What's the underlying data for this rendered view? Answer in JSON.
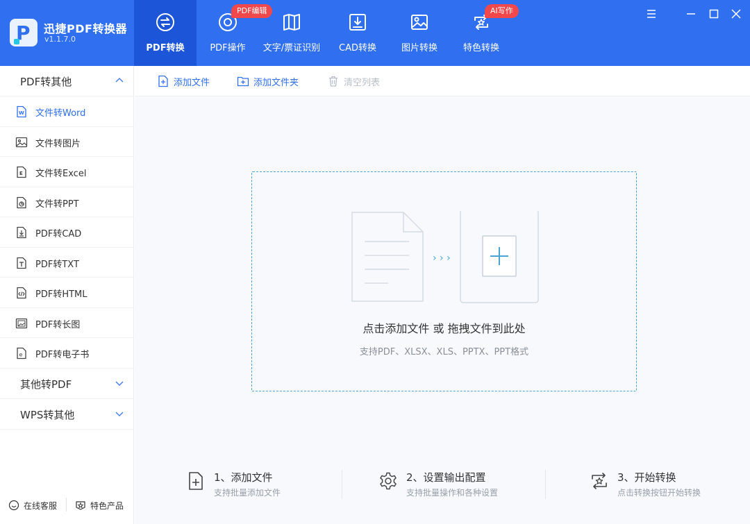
{
  "app": {
    "name": "迅捷PDF转换器",
    "version": "v1.1.7.0"
  },
  "tabs": [
    {
      "label": "PDF转换",
      "icon": "pdf-convert-icon",
      "active": true
    },
    {
      "label": "PDF操作",
      "icon": "pdf-operate-icon",
      "badge": "PDF编辑"
    },
    {
      "label": "文字/票证识别",
      "icon": "ocr-icon"
    },
    {
      "label": "CAD转换",
      "icon": "cad-icon"
    },
    {
      "label": "图片转换",
      "icon": "image-icon"
    },
    {
      "label": "特色转换",
      "icon": "special-icon",
      "badge": "AI写作"
    }
  ],
  "window_controls": [
    "menu-icon",
    "minimize-icon",
    "maximize-icon",
    "close-icon"
  ],
  "sidebar": {
    "categories": [
      {
        "label": "PDF转其他",
        "expanded": true
      },
      {
        "label": "其他转PDF",
        "expanded": false
      },
      {
        "label": "WPS转其他",
        "expanded": false
      }
    ],
    "items": [
      {
        "label": "文件转Word",
        "icon": "word-file-icon",
        "active": true
      },
      {
        "label": "文件转图片",
        "icon": "image-file-icon"
      },
      {
        "label": "文件转Excel",
        "icon": "excel-file-icon"
      },
      {
        "label": "文件转PPT",
        "icon": "ppt-file-icon"
      },
      {
        "label": "PDF转CAD",
        "icon": "cad-file-icon"
      },
      {
        "label": "PDF转TXT",
        "icon": "txt-file-icon"
      },
      {
        "label": "PDF转HTML",
        "icon": "html-file-icon"
      },
      {
        "label": "PDF转长图",
        "icon": "long-image-icon"
      },
      {
        "label": "PDF转电子书",
        "icon": "ebook-file-icon"
      }
    ],
    "footer": {
      "support": "在线客服",
      "products": "特色产品"
    }
  },
  "toolbar": {
    "add_file": "添加文件",
    "add_folder": "添加文件夹",
    "clear_list": "清空列表"
  },
  "dropzone": {
    "title": "点击添加文件 或 拖拽文件到此处",
    "subtitle": "支持PDF、XLSX、XLS、PPTX、PPT格式",
    "arrows": "› › ›"
  },
  "steps": [
    {
      "title": "1、添加文件",
      "sub": "支持批量添加文件"
    },
    {
      "title": "2、设置输出配置",
      "sub": "支持批量操作和各种设置"
    },
    {
      "title": "3、开始转换",
      "sub": "点击转换按钮开始转换"
    }
  ],
  "colors": {
    "primary": "#2f6ff0",
    "active_tab": "#1c55d8",
    "badge": "#f2484b",
    "dashed_border": "#4ba3d4"
  }
}
